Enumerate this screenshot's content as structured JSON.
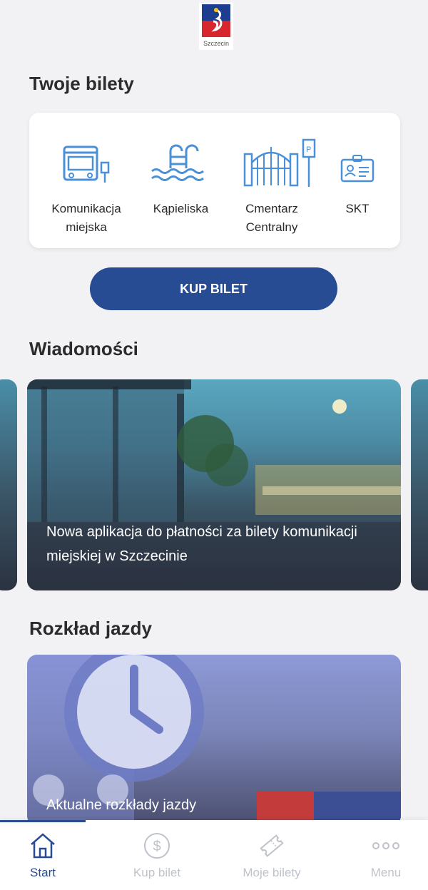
{
  "logo": {
    "caption": "Szczecin"
  },
  "tickets": {
    "title": "Twoje bilety",
    "types": [
      {
        "label": "Komunikacja\nmiejska",
        "icon": "bus-icon"
      },
      {
        "label": "Kąpieliska",
        "icon": "swimming-pool-icon"
      },
      {
        "label": "Cmentarz\nCentralny",
        "icon": "cemetery-parking-icon"
      },
      {
        "label": "SKT",
        "icon": "id-card-icon"
      }
    ],
    "buy_button": "KUP BILET"
  },
  "news": {
    "title": "Wiadomości",
    "items": [
      {
        "title": "Nowa aplikacja do płatności za bilety komunikacji miejskiej w Szczecinie"
      }
    ]
  },
  "timetable": {
    "title": "Rozkład jazdy",
    "card_title": "Aktualne rozkłady jazdy"
  },
  "nav": {
    "items": [
      {
        "label": "Start",
        "icon": "home-icon",
        "active": true
      },
      {
        "label": "Kup bilet",
        "icon": "dollar-coin-icon",
        "active": false
      },
      {
        "label": "Moje bilety",
        "icon": "ticket-icon",
        "active": false
      },
      {
        "label": "Menu",
        "icon": "more-dots-icon",
        "active": false
      }
    ]
  },
  "colors": {
    "accent": "#284c93",
    "icon_blue": "#4a90d9",
    "inactive": "#bfc2ca",
    "background": "#f2f2f4"
  }
}
